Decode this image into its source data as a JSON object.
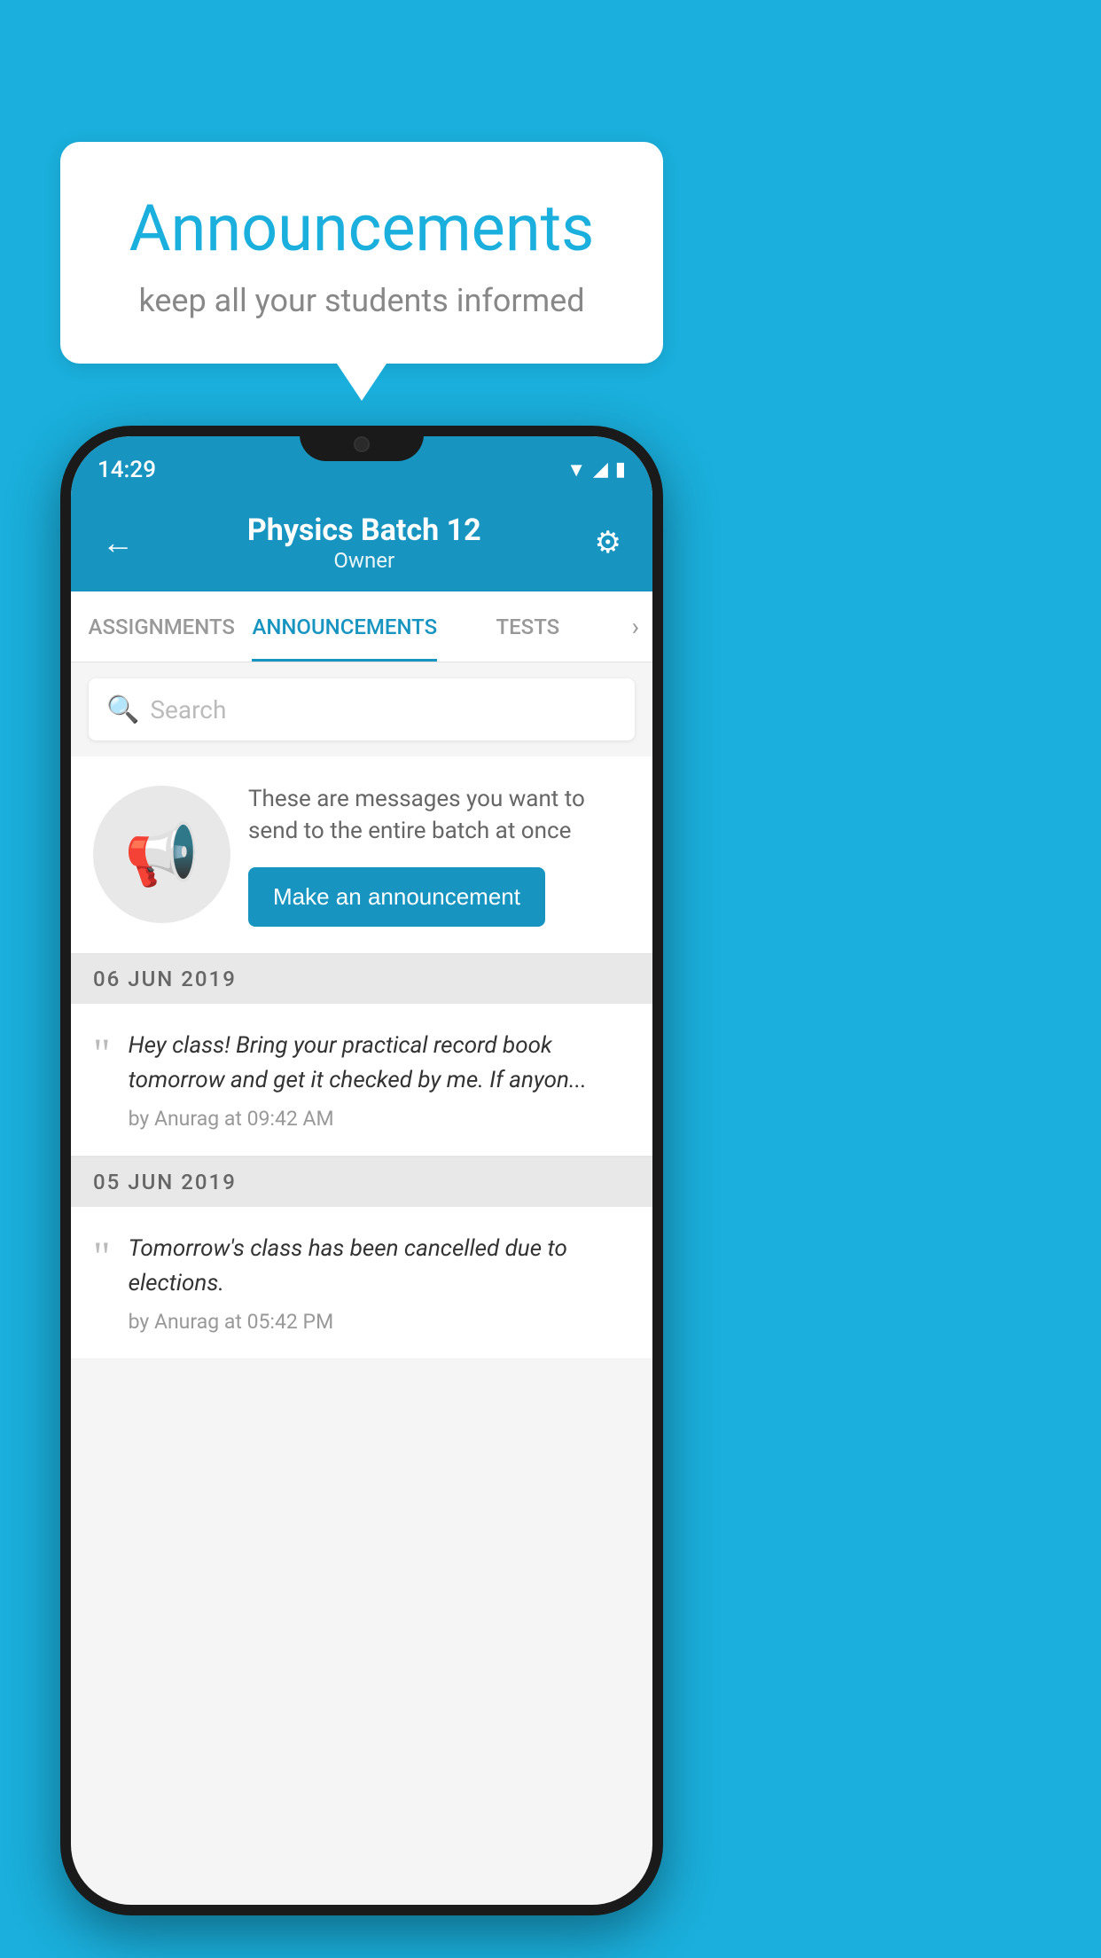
{
  "background_color": "#1AAFDC",
  "speech_bubble": {
    "title": "Announcements",
    "subtitle": "keep all your students informed"
  },
  "phone": {
    "status_bar": {
      "time": "14:29",
      "icons": [
        "wifi",
        "signal",
        "battery"
      ]
    },
    "app_bar": {
      "back_label": "←",
      "title": "Physics Batch 12",
      "subtitle": "Owner",
      "settings_label": "⚙"
    },
    "tabs": [
      {
        "label": "ASSIGNMENTS",
        "active": false
      },
      {
        "label": "ANNOUNCEMENTS",
        "active": true
      },
      {
        "label": "TESTS",
        "active": false
      }
    ],
    "search": {
      "placeholder": "Search"
    },
    "promo_card": {
      "description": "These are messages you want to send to the entire batch at once",
      "button_label": "Make an announcement"
    },
    "announcements": [
      {
        "date": "06  JUN  2019",
        "text": "Hey class! Bring your practical record book tomorrow and get it checked by me. If anyon...",
        "meta": "by Anurag at 09:42 AM"
      },
      {
        "date": "05  JUN  2019",
        "text": "Tomorrow's class has been cancelled due to elections.",
        "meta": "by Anurag at 05:42 PM"
      }
    ]
  }
}
